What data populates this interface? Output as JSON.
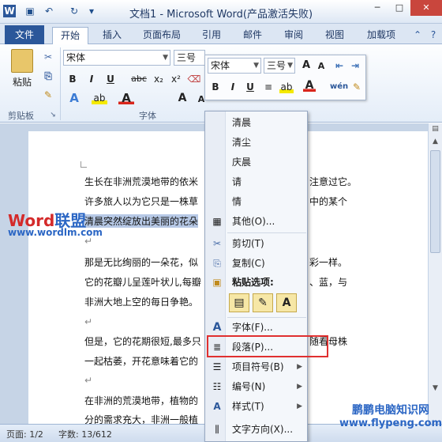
{
  "window": {
    "title": "文档1 - Microsoft Word(产品激活失败)"
  },
  "tabs": [
    "文件",
    "开始",
    "插入",
    "页面布局",
    "引用",
    "邮件",
    "审阅",
    "视图",
    "加载项"
  ],
  "ribbon": {
    "paste_label": "粘贴",
    "font_name": "宋体",
    "font_size": "三号",
    "clipboard_group": "剪贴板",
    "font_group": "字体"
  },
  "mini_toolbar": {
    "font_name": "宋体",
    "font_size": "三号"
  },
  "document": {
    "lines": [
      "生长在非洲荒漠地带的依米",
      "许多旅人以为它只是一株草",
      "清晨突然绽放出美丽的花朵",
      "那是无比绚丽的一朵花，似",
      "它的花瓣儿呈莲叶状儿,每瓣",
      "非洲大地上空的毎日争艳。",
      "但是，它的花期很短,最多只",
      "一起枯萎，开花意味着它的",
      "在非洲的荒漠地带，植物的",
      "分的需求充大，非洲一般植"
    ],
    "right_fragments": [
      "注意过它。",
      "中的某个",
      "彩一样。",
      "、蓝，与",
      "随看母株"
    ]
  },
  "context_menu": {
    "items": [
      "清晨",
      "清尘",
      "庆晨",
      "请",
      "情",
      "其他(O)...",
      "剪切(T)",
      "复制(C)",
      "粘贴选项:",
      "字体(F)...",
      "段落(P)...",
      "项目符号(B)",
      "编号(N)",
      "样式(T)",
      "文字方向(X)..."
    ]
  },
  "status": {
    "page": "页面: 1/2",
    "words": "字数: 13/612"
  },
  "watermarks": {
    "logo_red": "Word",
    "logo_blue": "联盟",
    "url": "www.wordlm.com",
    "site": "鹏鹏电脑知识网",
    "site_url": "www.flypeng.com"
  }
}
